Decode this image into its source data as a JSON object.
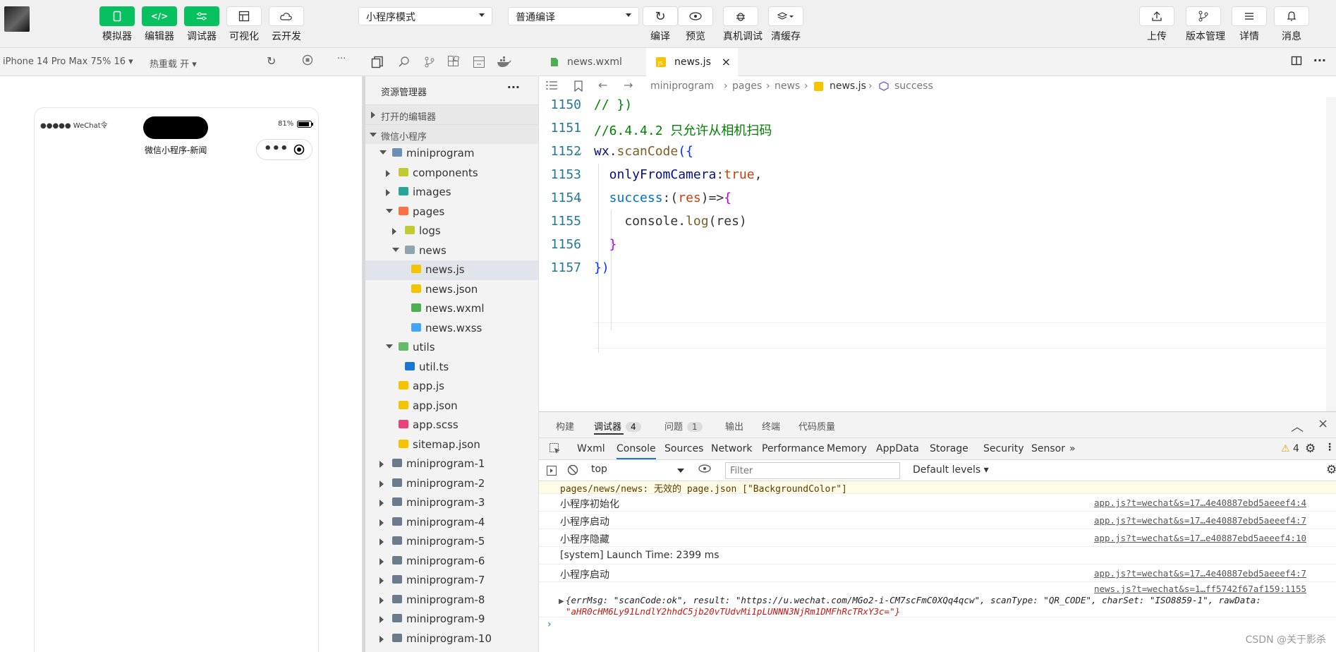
{
  "toolbar": {
    "buttons": [
      {
        "label": "模拟器",
        "icon": "phone-icon"
      },
      {
        "label": "编辑器",
        "icon": "code-icon"
      },
      {
        "label": "调试器",
        "icon": "debug-icon"
      },
      {
        "label": "可视化",
        "icon": "layout-icon"
      },
      {
        "label": "云开发",
        "icon": "cloud-icon"
      }
    ],
    "mode_select": "小程序模式",
    "compile_select": "普通编译",
    "actions": [
      {
        "label": "编译",
        "icon": "refresh-icon"
      },
      {
        "label": "预览",
        "icon": "eye-icon"
      },
      {
        "label": "真机调试",
        "icon": "bug-icon"
      },
      {
        "label": "清缓存",
        "icon": "layers-icon"
      }
    ],
    "right": [
      {
        "label": "上传",
        "icon": "upload-icon"
      },
      {
        "label": "版本管理",
        "icon": "branch-icon"
      },
      {
        "label": "详情",
        "icon": "menu-icon"
      },
      {
        "label": "消息",
        "icon": "bell-icon"
      }
    ]
  },
  "simulator": {
    "device": "iPhone 14 Pro Max 75% 16 ▾",
    "hot_reload": "热重载 开 ▾",
    "status_left": "●●●●● WeChat令",
    "battery": "81%",
    "page_title": "微信小程序-新闻"
  },
  "explorer": {
    "title": "资源管理器",
    "open_editors": "打开的编辑器",
    "project": "微信小程序",
    "tree": [
      {
        "name": "miniprogram",
        "level": 0,
        "twisty": "open",
        "color": "#6b8fb3"
      },
      {
        "name": "components",
        "level": 1,
        "twisty": "closed",
        "color": "#c0ca33"
      },
      {
        "name": "images",
        "level": 1,
        "twisty": "closed",
        "color": "#26a69a"
      },
      {
        "name": "pages",
        "level": 1,
        "twisty": "open",
        "color": "#ff7043"
      },
      {
        "name": "logs",
        "level": 2,
        "twisty": "closed",
        "color": "#c0ca33"
      },
      {
        "name": "news",
        "level": 2,
        "twisty": "open",
        "color": "#90a4ae"
      },
      {
        "name": "news.js",
        "level": 3,
        "twisty": "",
        "color": "#f5c400",
        "active": true
      },
      {
        "name": "news.json",
        "level": 3,
        "twisty": "",
        "color": "#f5c400"
      },
      {
        "name": "news.wxml",
        "level": 3,
        "twisty": "",
        "color": "#4caf50"
      },
      {
        "name": "news.wxss",
        "level": 3,
        "twisty": "",
        "color": "#42a5f5"
      },
      {
        "name": "utils",
        "level": 1,
        "twisty": "open",
        "color": "#66bb6a"
      },
      {
        "name": "util.ts",
        "level": 2,
        "twisty": "",
        "color": "#1976d2"
      },
      {
        "name": "app.js",
        "level": 1,
        "twisty": "",
        "color": "#f5c400"
      },
      {
        "name": "app.json",
        "level": 1,
        "twisty": "",
        "color": "#f5c400"
      },
      {
        "name": "app.scss",
        "level": 1,
        "twisty": "",
        "color": "#ec407a"
      },
      {
        "name": "sitemap.json",
        "level": 1,
        "twisty": "",
        "color": "#f5c400"
      },
      {
        "name": "miniprogram-1",
        "level": 0,
        "twisty": "closed",
        "color": "#6b7b8c"
      },
      {
        "name": "miniprogram-2",
        "level": 0,
        "twisty": "closed",
        "color": "#6b7b8c"
      },
      {
        "name": "miniprogram-3",
        "level": 0,
        "twisty": "closed",
        "color": "#6b7b8c"
      },
      {
        "name": "miniprogram-4",
        "level": 0,
        "twisty": "closed",
        "color": "#6b7b8c"
      },
      {
        "name": "miniprogram-5",
        "level": 0,
        "twisty": "closed",
        "color": "#6b7b8c"
      },
      {
        "name": "miniprogram-6",
        "level": 0,
        "twisty": "closed",
        "color": "#6b7b8c"
      },
      {
        "name": "miniprogram-7",
        "level": 0,
        "twisty": "closed",
        "color": "#6b7b8c"
      },
      {
        "name": "miniprogram-8",
        "level": 0,
        "twisty": "closed",
        "color": "#6b7b8c"
      },
      {
        "name": "miniprogram-9",
        "level": 0,
        "twisty": "closed",
        "color": "#6b7b8c"
      },
      {
        "name": "miniprogram-10",
        "level": 0,
        "twisty": "closed",
        "color": "#6b7b8c"
      }
    ]
  },
  "editor": {
    "tabs": [
      {
        "label": "news.wxml",
        "active": false
      },
      {
        "label": "news.js",
        "active": true
      }
    ],
    "breadcrumb": [
      "miniprogram",
      "pages",
      "news",
      "news.js",
      "success"
    ],
    "lines": [
      {
        "num": "1150",
        "tokens": [
          {
            "t": "// })",
            "c": "#008000"
          }
        ]
      },
      {
        "num": "1151",
        "tokens": [
          {
            "t": "//6.4.4.2 只允许从相机扫码",
            "c": "#008000"
          }
        ]
      },
      {
        "num": "1152",
        "tokens": [
          {
            "t": "wx",
            "c": "#001080"
          },
          {
            "t": ".",
            "c": "#333"
          },
          {
            "t": "scanCode",
            "c": "#795e26"
          },
          {
            "t": "({",
            "c": "#0431fa"
          }
        ]
      },
      {
        "num": "1153",
        "tokens": [
          {
            "t": "  onlyFromCamera",
            "c": "#001080"
          },
          {
            "t": ":",
            "c": "#333"
          },
          {
            "t": "true",
            "c": "#c2410c"
          },
          {
            "t": ",",
            "c": "#333"
          }
        ]
      },
      {
        "num": "1154",
        "tokens": [
          {
            "t": "  success",
            "c": "#0070c1"
          },
          {
            "t": ":(",
            "c": "#333"
          },
          {
            "t": "res",
            "c": "#c2410c"
          },
          {
            "t": ")=>",
            "c": "#333"
          },
          {
            "t": "{",
            "c": "#af00db"
          }
        ]
      },
      {
        "num": "1155",
        "tokens": [
          {
            "t": "    console",
            "c": "#333"
          },
          {
            "t": ".",
            "c": "#333"
          },
          {
            "t": "log",
            "c": "#795e26"
          },
          {
            "t": "(res)",
            "c": "#333"
          }
        ]
      },
      {
        "num": "1156",
        "tokens": [
          {
            "t": "  }",
            "c": "#af00db"
          }
        ]
      },
      {
        "num": "1157",
        "tokens": [
          {
            "t": "})",
            "c": "#0431fa"
          }
        ]
      }
    ]
  },
  "debugger": {
    "top_tabs": [
      {
        "label": "构建"
      },
      {
        "label": "调试器",
        "badge": "4",
        "active": true
      },
      {
        "label": "问题",
        "badge": "1"
      },
      {
        "label": "输出"
      },
      {
        "label": "终端"
      },
      {
        "label": "代码质量"
      }
    ],
    "console_tabs": [
      "Wxml",
      "Console",
      "Sources",
      "Network",
      "Performance",
      "Memory",
      "AppData",
      "Storage",
      "Security",
      "Sensor"
    ],
    "warn_count": "4",
    "context": "top",
    "filter_placeholder": "Filter",
    "levels": "Default levels ▾",
    "logs": [
      {
        "text": "pages/news/news: 无效的 page.json [\"BackgroundColor\"]",
        "src": "",
        "type": "warn"
      },
      {
        "text": "小程序初始化",
        "src": "app.js?t=wechat&s=17…4e40887ebd5aeeef4:4",
        "type": "log"
      },
      {
        "text": "小程序启动",
        "src": "app.js?t=wechat&s=17…4e40887ebd5aeeef4:7",
        "type": "log"
      },
      {
        "text": "小程序隐藏",
        "src": "app.js?t=wechat&s=17…e40887ebd5aeeef4:10",
        "type": "log"
      },
      {
        "text": "[system] Launch Time: 2399 ms",
        "src": "",
        "type": "log"
      },
      {
        "text": "小程序启动",
        "src": "app.js?t=wechat&s=17…4e40887ebd5aeeef4:7",
        "type": "log"
      }
    ],
    "object_src": "news.js?t=wechat&s=1…ff5742f67af159:1155",
    "object_line1": "{errMsg: \"scanCode:ok\", result: \"https://u.wechat.com/MGo2-i-CM7scFmC0XQq4qcw\", scanType: \"QR_CODE\", charSet: \"ISO8859-1\", rawData:",
    "object_line2": "\"aHR0cHM6Ly91LndlY2hhdC5jb20vTUdvMi1pLUNNN3NjRm1DMFhRcTRxY3c=\"}",
    "watermark": "CSDN @关于影杀"
  }
}
